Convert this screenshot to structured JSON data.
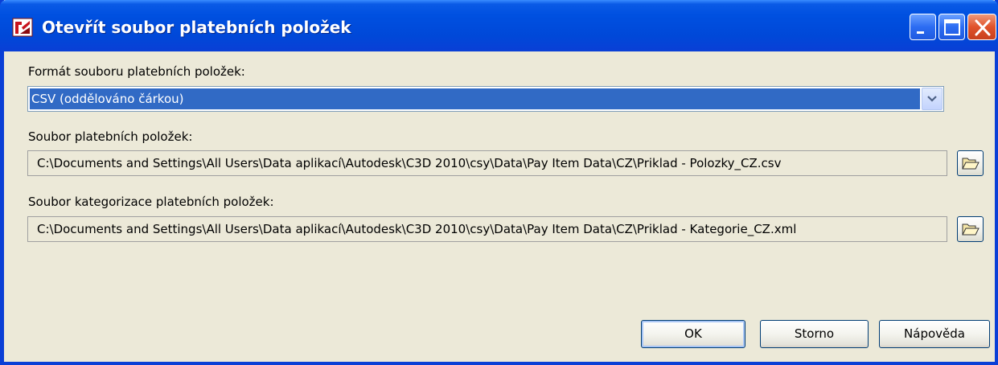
{
  "window": {
    "title": "Otevřít soubor platebních položek",
    "icon": "autodesk-app-icon",
    "controls": [
      "minimize-icon",
      "maximize-icon",
      "close-icon"
    ],
    "colors": {
      "titlebar": "#0050e0",
      "frame": "#0a3fd6",
      "body": "#ece9d8",
      "selection": "#316ac5",
      "close_button": "#e0522a"
    }
  },
  "format": {
    "label": "Formát souboru platebních položek:",
    "selected": "CSV (oddělováno čárkou)",
    "arrow_icon": "chevron-down-icon"
  },
  "pay_item_file": {
    "label": "Soubor platebních položek:",
    "path": "C:\\Documents and Settings\\All Users\\Data aplikací\\Autodesk\\C3D 2010\\csy\\Data\\Pay Item Data\\CZ\\Priklad - Polozky_CZ.csv",
    "browse_icon": "folder-open-icon"
  },
  "categorization_file": {
    "label": "Soubor kategorizace platebních položek:",
    "path": "C:\\Documents and Settings\\All Users\\Data aplikací\\Autodesk\\C3D 2010\\csy\\Data\\Pay Item Data\\CZ\\Priklad - Kategorie_CZ.xml",
    "browse_icon": "folder-open-icon"
  },
  "buttons": {
    "ok": "OK",
    "cancel": "Storno",
    "help": "Nápověda"
  }
}
